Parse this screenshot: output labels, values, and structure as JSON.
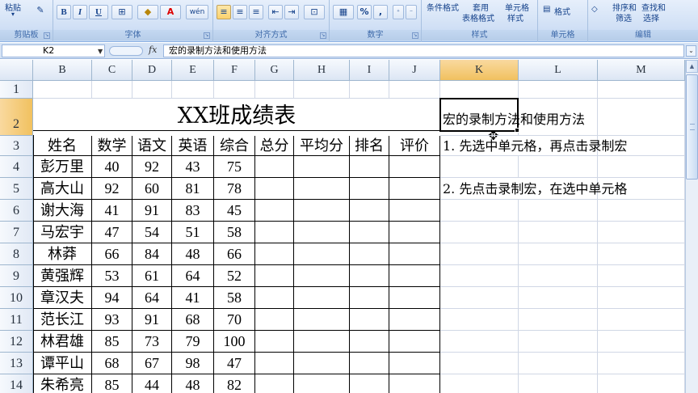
{
  "ribbon": {
    "paste_label": "粘贴",
    "clipboard_label": "剪贴板",
    "font_label": "字体",
    "alignment_label": "对齐方式",
    "number_label": "数字",
    "styles_label": "样式",
    "cells_label": "单元格",
    "editing_label": "编辑",
    "bold": "B",
    "italic": "I",
    "underline": "U",
    "font_color_letter": "A",
    "wen_label": "wén",
    "percent": "%",
    "comma": ",",
    "cond_format": "条件格式",
    "table_format_top": "套用",
    "table_format_bottom": "表格格式",
    "cell_style_top": "单元格",
    "cell_style_bottom": "样式",
    "format_label": "格式",
    "sort_filter_top": "排序和",
    "sort_filter_bottom": "筛选",
    "find_select_top": "查找和",
    "find_select_bottom": "选择"
  },
  "formula_bar": {
    "name_box": "K2",
    "fx": "fx",
    "content": "宏的录制方法和使用方法"
  },
  "columns": [
    "B",
    "C",
    "D",
    "E",
    "F",
    "G",
    "H",
    "I",
    "J",
    "K",
    "L",
    "M"
  ],
  "rows": [
    "1",
    "2",
    "3",
    "4",
    "5",
    "6",
    "7",
    "8",
    "9",
    "10",
    "11",
    "12",
    "13",
    "14"
  ],
  "sheet": {
    "title": "XX班成绩表",
    "headers": [
      "姓名",
      "数学",
      "语文",
      "英语",
      "综合",
      "总分",
      "平均分",
      "排名",
      "评价"
    ],
    "data": [
      [
        "彭万里",
        "40",
        "92",
        "43",
        "75"
      ],
      [
        "高大山",
        "92",
        "60",
        "81",
        "78"
      ],
      [
        "谢大海",
        "41",
        "91",
        "83",
        "45"
      ],
      [
        "马宏宇",
        "47",
        "54",
        "51",
        "58"
      ],
      [
        "林莽",
        "66",
        "84",
        "48",
        "66"
      ],
      [
        "黄强辉",
        "53",
        "61",
        "64",
        "52"
      ],
      [
        "章汉夫",
        "94",
        "64",
        "41",
        "58"
      ],
      [
        "范长江",
        "93",
        "91",
        "68",
        "70"
      ],
      [
        "林君雄",
        "85",
        "73",
        "79",
        "100"
      ],
      [
        "谭平山",
        "68",
        "67",
        "98",
        "47"
      ],
      [
        "朱希亮",
        "85",
        "44",
        "48",
        "82"
      ]
    ],
    "k2": "宏的录制方法和使用方法",
    "k3": "1. 先选中单元格，再点击录制宏",
    "k5": "2. 先点击录制宏，在选中单元格"
  }
}
